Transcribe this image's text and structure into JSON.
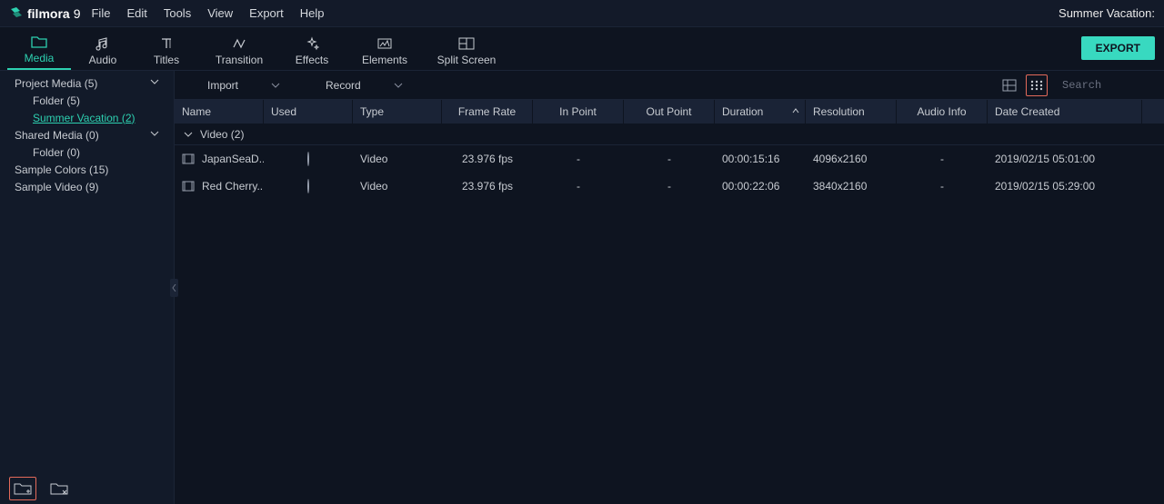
{
  "app": {
    "name": "filmora",
    "version_glyph": "9",
    "project_title": "Summer Vacation:"
  },
  "menu": {
    "items": [
      "File",
      "Edit",
      "Tools",
      "View",
      "Export",
      "Help"
    ]
  },
  "tabs": {
    "items": [
      {
        "label": "Media",
        "active": true
      },
      {
        "label": "Audio"
      },
      {
        "label": "Titles"
      },
      {
        "label": "Transition"
      },
      {
        "label": "Effects"
      },
      {
        "label": "Elements"
      },
      {
        "label": "Split Screen"
      }
    ],
    "export_label": "EXPORT"
  },
  "sidebar": {
    "items": [
      {
        "label": "Project Media (5)",
        "level": 0,
        "expandable": true
      },
      {
        "label": "Folder (5)",
        "level": 1
      },
      {
        "label": "Summer Vacation (2)",
        "level": 1,
        "selected": true
      },
      {
        "label": "Shared Media (0)",
        "level": 0,
        "expandable": true
      },
      {
        "label": "Folder (0)",
        "level": 1
      },
      {
        "label": "Sample Colors (15)",
        "level": 0
      },
      {
        "label": "Sample Video (9)",
        "level": 0
      }
    ]
  },
  "toolbar": {
    "import_label": "Import",
    "record_label": "Record",
    "search_placeholder": "Search"
  },
  "columns": [
    "Name",
    "Used",
    "Type",
    "Frame Rate",
    "In Point",
    "Out Point",
    "Duration",
    "Resolution",
    "Audio Info",
    "Date Created"
  ],
  "group": {
    "label": "Video (2)"
  },
  "rows": [
    {
      "name": "JapanSeaD...",
      "used": true,
      "type": "Video",
      "frame_rate": "23.976 fps",
      "in_point": "-",
      "out_point": "-",
      "duration": "00:00:15:16",
      "resolution": "4096x2160",
      "audio_info": "-",
      "date_created": "2019/02/15 05:01:00"
    },
    {
      "name": "Red Cherry...",
      "used": true,
      "type": "Video",
      "frame_rate": "23.976 fps",
      "in_point": "-",
      "out_point": "-",
      "duration": "00:00:22:06",
      "resolution": "3840x2160",
      "audio_info": "-",
      "date_created": "2019/02/15 05:29:00"
    }
  ]
}
